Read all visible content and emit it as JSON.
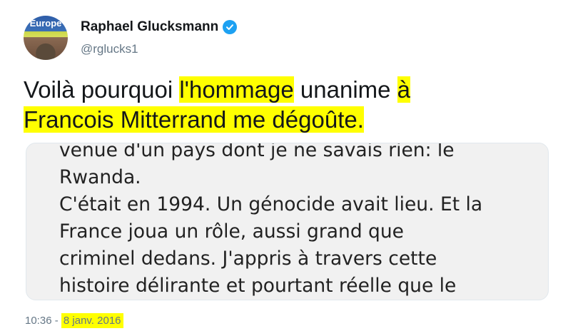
{
  "author": {
    "name": "Raphael Glucksmann",
    "handle": "@rglucks1",
    "avatar_text": "Europe",
    "verified_icon": "verified-badge-icon"
  },
  "tweet": {
    "text_parts": [
      "Voilà pourquoi ",
      "l'hommage",
      " unanime ",
      "à",
      " ",
      "Francois Mitterrand me dégoûte."
    ]
  },
  "media": {
    "text": "venue d'un pays dont je ne savais rien: le\nRwanda.\nC'était en 1994. Un génocide avait lieu. Et la\nFrance joua un rôle, aussi grand que\ncriminel dedans. J'appris à travers cette\nhistoire délirante et pourtant réelle que le"
  },
  "meta": {
    "time": "10:36",
    "separator": " - ",
    "date": "8 janv. 2016"
  },
  "colors": {
    "highlight": "#ffff00",
    "verified": "#1da1f2",
    "secondary_text": "#657786"
  }
}
